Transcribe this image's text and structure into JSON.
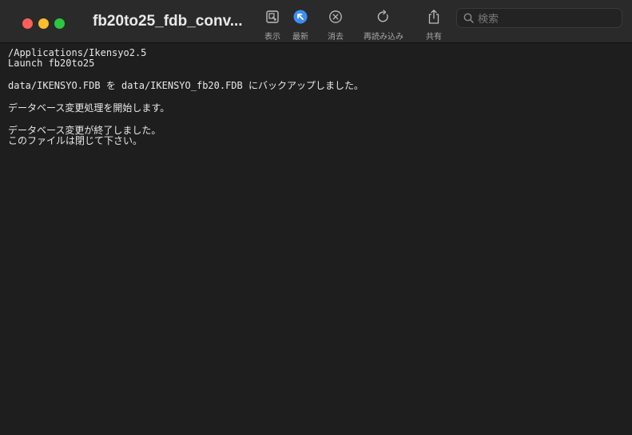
{
  "window": {
    "title": "fb20to25_fdb_conv...",
    "background": "#1e1e1e"
  },
  "toolbar": {
    "buttons": [
      {
        "label": "表示",
        "icon": "display-icon"
      },
      {
        "label": "最新",
        "icon": "latest-icon",
        "active_color": "#3c8ef5"
      },
      {
        "label": "消去",
        "icon": "clear-icon"
      },
      {
        "label": "再読み込み",
        "icon": "reload-icon"
      },
      {
        "label": "共有",
        "icon": "share-icon"
      }
    ],
    "search": {
      "placeholder": "検索",
      "icon": "search-icon"
    }
  },
  "terminal": {
    "lines": [
      "/Applications/Ikensyo2.5",
      "Launch fb20to25",
      "",
      "data/IKENSYO.FDB を data/IKENSYO_fb20.FDB にバックアップしました。",
      "",
      "データベース変更処理を開始します。",
      "",
      "データベース変更が終了しました。",
      "このファイルは閉じて下さい。"
    ]
  }
}
